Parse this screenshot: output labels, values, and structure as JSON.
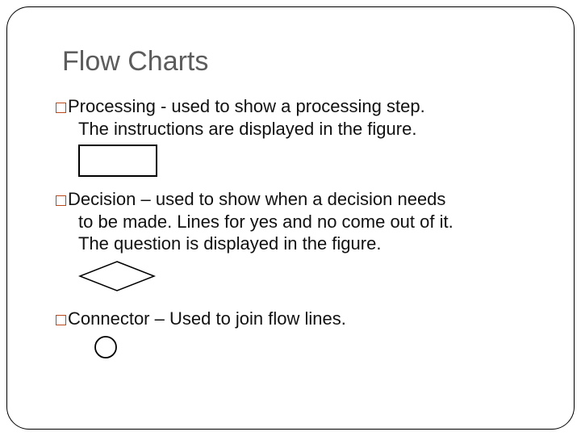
{
  "title": "Flow Charts",
  "items": [
    {
      "term": "Processing",
      "sep": " -  ",
      "def1": "used to show a processing step.",
      "cont1": "The instructions are displayed in the figure.",
      "cont2": "",
      "shape": "rect"
    },
    {
      "term": "Decision",
      "sep": " – ",
      "def1": "used to show when a decision needs",
      "cont1": "to be made.  Lines for yes and no come out of it.",
      "cont2": "The question is displayed in the figure.",
      "shape": "diamond"
    },
    {
      "term": "Connector",
      "sep": " – ",
      "def1": "Used to join flow lines.",
      "cont1": "",
      "cont2": "",
      "shape": "circle"
    }
  ]
}
